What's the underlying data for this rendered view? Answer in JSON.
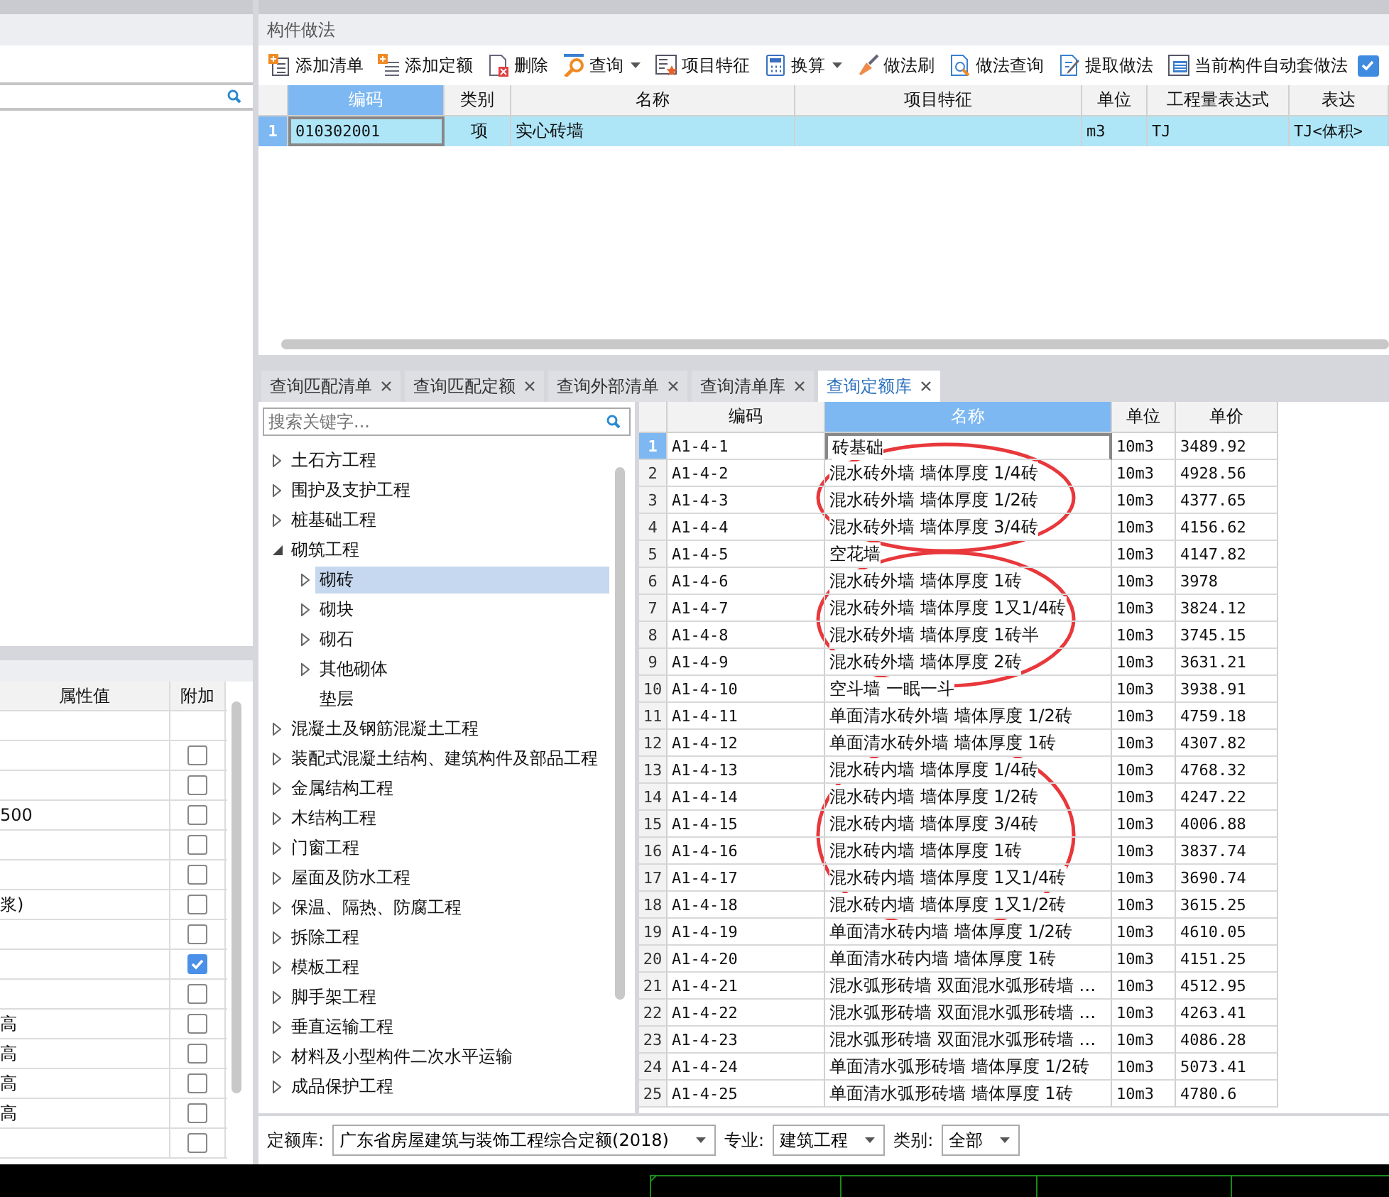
{
  "property_panel": {
    "columns": [
      {
        "label": "属性值"
      },
      {
        "label": "附加"
      }
    ],
    "rows": [
      {
        "kind": "blank"
      },
      {
        "kind": "check",
        "checked": false
      },
      {
        "kind": "check",
        "checked": false
      },
      {
        "kind": "check",
        "value": "500",
        "checked": false
      },
      {
        "kind": "check",
        "checked": false
      },
      {
        "kind": "check",
        "checked": false
      },
      {
        "kind": "check",
        "value": "浆)",
        "checked": false
      },
      {
        "kind": "check",
        "checked": false
      },
      {
        "kind": "check",
        "checked": true
      },
      {
        "kind": "check",
        "checked": false
      },
      {
        "kind": "check",
        "value": "高",
        "checked": false
      },
      {
        "kind": "check",
        "value": "高",
        "checked": false
      },
      {
        "kind": "check",
        "value": "高",
        "checked": false
      },
      {
        "kind": "check",
        "value": "高",
        "checked": false
      },
      {
        "kind": "check",
        "checked": false
      }
    ]
  },
  "method_panel": {
    "title": "构件做法",
    "toolbar": [
      {
        "label": "添加清单"
      },
      {
        "label": "添加定额"
      },
      {
        "label": "删除"
      },
      {
        "label": "查询",
        "dropdown": true
      },
      {
        "label": "项目特征"
      },
      {
        "label": "换算",
        "dropdown": true
      },
      {
        "label": "做法刷"
      },
      {
        "label": "做法查询"
      },
      {
        "label": "提取做法"
      },
      {
        "label": "当前构件自动套做法"
      }
    ],
    "auto_checkbox": {
      "checked": true
    },
    "table": {
      "columns": [
        {
          "label": "编码",
          "selected": true
        },
        {
          "label": "类别",
          "selected": false
        },
        {
          "label": "名称",
          "selected": false
        },
        {
          "label": "项目特征",
          "selected": false
        },
        {
          "label": "单位",
          "selected": false
        },
        {
          "label": "工程量表达式",
          "selected": false
        },
        {
          "label": "表达",
          "selected": false
        }
      ],
      "rows": [
        {
          "index": "1",
          "code": "010302001",
          "category": "项",
          "name": "实心砖墙",
          "unit": "m3",
          "expression": "TJ",
          "column_8": "TJ<体积>",
          "selected": true
        }
      ]
    }
  },
  "query_tabs": [
    {
      "label": "查询匹配清单",
      "selected": false
    },
    {
      "label": "查询匹配定额",
      "selected": false
    },
    {
      "label": "查询外部清单",
      "selected": false
    },
    {
      "label": "查询清单库",
      "selected": false
    },
    {
      "label": "查询定额库",
      "selected": true
    }
  ],
  "tree": {
    "search": {
      "placeholder": "搜索关键字..."
    },
    "items": [
      {
        "label": "土石方工程",
        "expanded": false,
        "selected": false
      },
      {
        "label": "围护及支护工程",
        "expanded": false,
        "selected": false
      },
      {
        "label": "桩基础工程",
        "expanded": false,
        "selected": false
      },
      {
        "label": "砌筑工程",
        "expanded": true,
        "selected": false,
        "children": [
          {
            "label": "砌砖",
            "expanded": false,
            "selected": true
          },
          {
            "label": "砌块",
            "expanded": false,
            "selected": false
          },
          {
            "label": "砌石",
            "expanded": false,
            "selected": false
          },
          {
            "label": "其他砌体",
            "expanded": false,
            "selected": false
          },
          {
            "label": "垫层",
            "selected": false
          }
        ]
      },
      {
        "label": "混凝土及钢筋混凝土工程",
        "expanded": false,
        "selected": false
      },
      {
        "label": "装配式混凝土结构、建筑构件及部品工程",
        "expanded": false,
        "selected": false
      },
      {
        "label": "金属结构工程",
        "expanded": false,
        "selected": false
      },
      {
        "label": "木结构工程",
        "expanded": false,
        "selected": false
      },
      {
        "label": "门窗工程",
        "expanded": false,
        "selected": false
      },
      {
        "label": "屋面及防水工程",
        "expanded": false,
        "selected": false
      },
      {
        "label": "保温、隔热、防腐工程",
        "expanded": false,
        "selected": false
      },
      {
        "label": "拆除工程",
        "expanded": false,
        "selected": false
      },
      {
        "label": "模板工程",
        "expanded": false,
        "selected": false
      },
      {
        "label": "脚手架工程",
        "expanded": false,
        "selected": false
      },
      {
        "label": "垂直运输工程",
        "expanded": false,
        "selected": false
      },
      {
        "label": "材料及小型构件二次水平运输",
        "expanded": false,
        "selected": false
      },
      {
        "label": "成品保护工程",
        "expanded": false,
        "selected": false
      }
    ]
  },
  "quota_table": {
    "columns": [
      {
        "label": "编码",
        "selected": false
      },
      {
        "label": "名称",
        "selected": true
      },
      {
        "label": "单位",
        "selected": false
      },
      {
        "label": "单价",
        "selected": false
      }
    ],
    "rows": [
      {
        "index": "1",
        "code": "A1-4-1",
        "name": "砖基础",
        "unit": "10m3",
        "price": "3489.92",
        "selected": true,
        "circled": false
      },
      {
        "index": "2",
        "code": "A1-4-2",
        "name": "混水砖外墙 墙体厚度 1/4砖",
        "unit": "10m3",
        "price": "4928.56",
        "selected": false,
        "circled": true
      },
      {
        "index": "3",
        "code": "A1-4-3",
        "name": "混水砖外墙 墙体厚度 1/2砖",
        "unit": "10m3",
        "price": "4377.65",
        "selected": false,
        "circled": true
      },
      {
        "index": "4",
        "code": "A1-4-4",
        "name": "混水砖外墙 墙体厚度 3/4砖",
        "unit": "10m3",
        "price": "4156.62",
        "selected": false,
        "circled": true
      },
      {
        "index": "5",
        "code": "A1-4-5",
        "name": "空花墙",
        "unit": "10m3",
        "price": "4147.82",
        "selected": false,
        "circled": false
      },
      {
        "index": "6",
        "code": "A1-4-6",
        "name": "混水砖外墙 墙体厚度 1砖",
        "unit": "10m3",
        "price": "3978",
        "selected": false,
        "circled": true
      },
      {
        "index": "7",
        "code": "A1-4-7",
        "name": "混水砖外墙 墙体厚度 1又1/4砖",
        "unit": "10m3",
        "price": "3824.12",
        "selected": false,
        "circled": true
      },
      {
        "index": "8",
        "code": "A1-4-8",
        "name": "混水砖外墙 墙体厚度 1砖半",
        "unit": "10m3",
        "price": "3745.15",
        "selected": false,
        "circled": true
      },
      {
        "index": "9",
        "code": "A1-4-9",
        "name": "混水砖外墙 墙体厚度 2砖",
        "unit": "10m3",
        "price": "3631.21",
        "selected": false,
        "circled": true
      },
      {
        "index": "10",
        "code": "A1-4-10",
        "name": "空斗墙 一眠一斗",
        "unit": "10m3",
        "price": "3938.91",
        "selected": false,
        "circled": false
      },
      {
        "index": "11",
        "code": "A1-4-11",
        "name": "单面清水砖外墙 墙体厚度 1/2砖",
        "unit": "10m3",
        "price": "4759.18",
        "selected": false,
        "circled": false
      },
      {
        "index": "12",
        "code": "A1-4-12",
        "name": "单面清水砖外墙 墙体厚度 1砖",
        "unit": "10m3",
        "price": "4307.82",
        "selected": false,
        "circled": false
      },
      {
        "index": "13",
        "code": "A1-4-13",
        "name": "混水砖内墙 墙体厚度 1/4砖",
        "unit": "10m3",
        "price": "4768.32",
        "selected": false,
        "circled": true
      },
      {
        "index": "14",
        "code": "A1-4-14",
        "name": "混水砖内墙 墙体厚度 1/2砖",
        "unit": "10m3",
        "price": "4247.22",
        "selected": false,
        "circled": true
      },
      {
        "index": "15",
        "code": "A1-4-15",
        "name": "混水砖内墙 墙体厚度 3/4砖",
        "unit": "10m3",
        "price": "4006.88",
        "selected": false,
        "circled": true
      },
      {
        "index": "16",
        "code": "A1-4-16",
        "name": "混水砖内墙 墙体厚度 1砖",
        "unit": "10m3",
        "price": "3837.74",
        "selected": false,
        "circled": true
      },
      {
        "index": "17",
        "code": "A1-4-17",
        "name": "混水砖内墙 墙体厚度 1又1/4砖",
        "unit": "10m3",
        "price": "3690.74",
        "selected": false,
        "circled": true
      },
      {
        "index": "18",
        "code": "A1-4-18",
        "name": "混水砖内墙 墙体厚度 1又1/2砖",
        "unit": "10m3",
        "price": "3615.25",
        "selected": false,
        "circled": true
      },
      {
        "index": "19",
        "code": "A1-4-19",
        "name": "单面清水砖内墙 墙体厚度 1/2砖",
        "unit": "10m3",
        "price": "4610.05",
        "selected": false,
        "circled": false
      },
      {
        "index": "20",
        "code": "A1-4-20",
        "name": "单面清水砖内墙 墙体厚度 1砖",
        "unit": "10m3",
        "price": "4151.25",
        "selected": false,
        "circled": false
      },
      {
        "index": "21",
        "code": "A1-4-21",
        "name": "混水弧形砖墙 双面混水弧形砖墙 …",
        "unit": "10m3",
        "price": "4512.95",
        "selected": false,
        "circled": false
      },
      {
        "index": "22",
        "code": "A1-4-22",
        "name": "混水弧形砖墙 双面混水弧形砖墙 …",
        "unit": "10m3",
        "price": "4263.41",
        "selected": false,
        "circled": false
      },
      {
        "index": "23",
        "code": "A1-4-23",
        "name": "混水弧形砖墙 双面混水弧形砖墙 …",
        "unit": "10m3",
        "price": "4086.28",
        "selected": false,
        "circled": false
      },
      {
        "index": "24",
        "code": "A1-4-24",
        "name": "单面清水弧形砖墙 墙体厚度 1/2砖",
        "unit": "10m3",
        "price": "5073.41",
        "selected": false,
        "circled": false
      },
      {
        "index": "25",
        "code": "A1-4-25",
        "name": "单面清水弧形砖墙 墙体厚度 1砖",
        "unit": "10m3",
        "price": "4780.6",
        "selected": false,
        "circled": false
      }
    ]
  },
  "filter_bar": [
    {
      "label": "定额库:",
      "value": "广东省房屋建筑与装饰工程综合定额(2018)"
    },
    {
      "label": "专业:",
      "value": "建筑工程"
    },
    {
      "label": "类别:",
      "value": "全部"
    }
  ]
}
